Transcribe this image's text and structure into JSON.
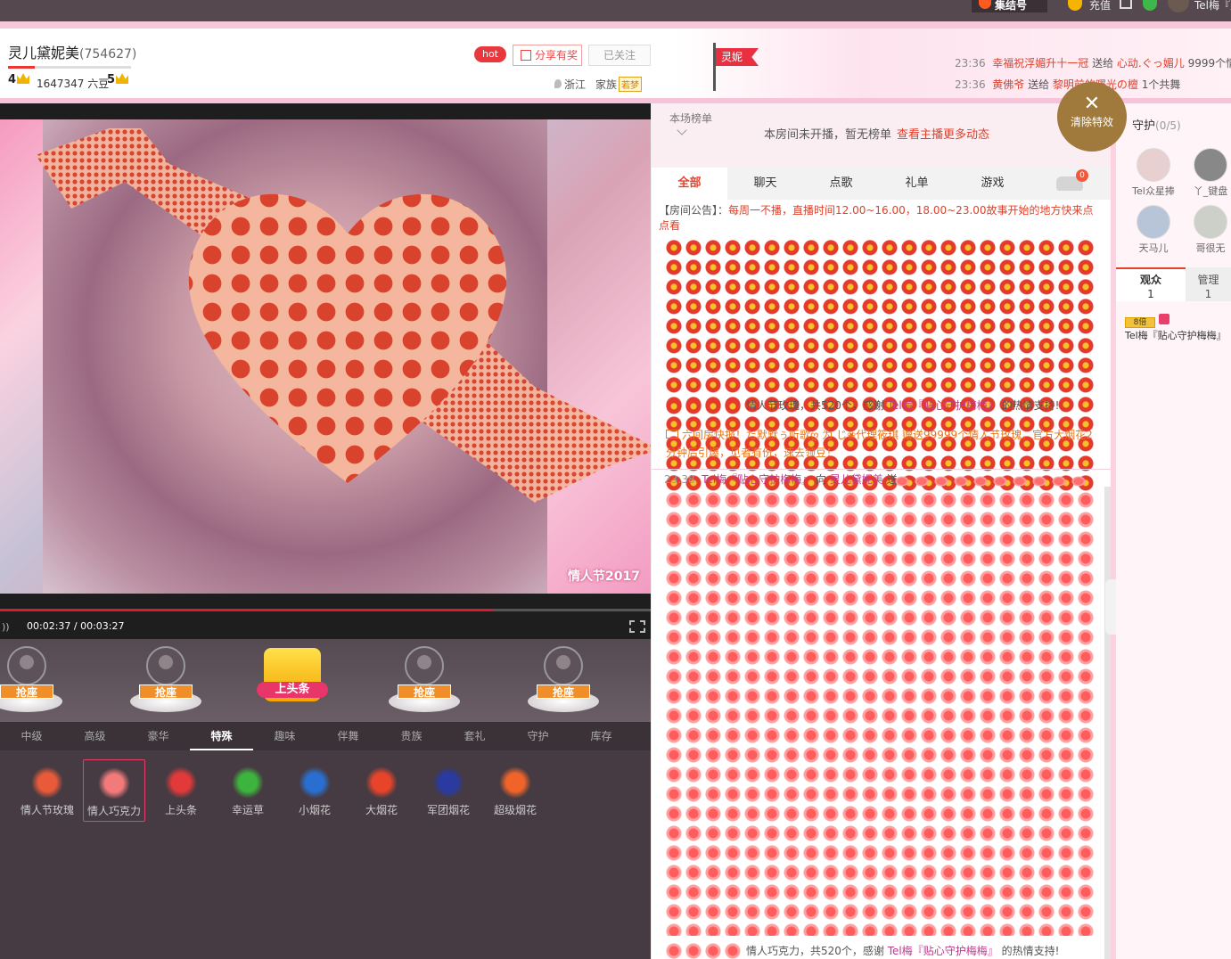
{
  "topbar": {
    "store": "集结号",
    "recharge": "充值",
    "username": "Tel梅『贴心"
  },
  "room": {
    "anchor_name": "灵儿黛妮美",
    "room_id": "(754627)",
    "level_left": "4",
    "coins": "1647347 六豆",
    "level_right": "5",
    "hot_label": "hot",
    "share_label": "分享有奖",
    "follow_label": "已关注",
    "location": "浙江",
    "family_label": "家族",
    "family_name": "若梦",
    "flag_name": "灵妮"
  },
  "feed": [
    {
      "time": "23:36",
      "sender": "幸福祝浮媚升十一冠",
      "verb": "送给",
      "receiver": "心动.ぐっ媚儿",
      "gift": "9999个情"
    },
    {
      "time": "23:36",
      "sender": "黄佛爷",
      "verb": "送给",
      "receiver": "黎明前的曙光の檀",
      "gift": "1个共舞"
    }
  ],
  "player": {
    "time": "00:02:37 / 00:03:27",
    "progress": 0.759,
    "badge": "情人节2017"
  },
  "seats": {
    "grab_label": "抢座",
    "headline_label": "上头条"
  },
  "gift_tabs": [
    "中级",
    "高级",
    "豪华",
    "特殊",
    "趣味",
    "伴舞",
    "贵族",
    "套礼",
    "守护",
    "库存"
  ],
  "gift_tab_active": "特殊",
  "gifts": [
    {
      "name": "情人节玫瑰",
      "icon": "rose-bouquet-icon",
      "color": "#e85a3a"
    },
    {
      "name": "情人巧克力",
      "icon": "chocolate-heart-icon",
      "color": "#f27a7a"
    },
    {
      "name": "上头条",
      "icon": "headline-sign-icon",
      "color": "#e23a3a"
    },
    {
      "name": "幸运草",
      "icon": "clover-icon",
      "color": "#3db43d"
    },
    {
      "name": "小烟花",
      "icon": "small-firework-icon",
      "color": "#2a6fd0"
    },
    {
      "name": "大烟花",
      "icon": "big-firework-icon",
      "color": "#e8442a"
    },
    {
      "name": "军团烟花",
      "icon": "legion-firework-icon",
      "color": "#2a3aa0"
    },
    {
      "name": "超级烟花",
      "icon": "super-firework-icon",
      "color": "#f0642a"
    }
  ],
  "chat": {
    "rank_label": "本场榜单",
    "rank_message": "本房间未开播，暂无榜单",
    "rank_link": "查看主播更多动态",
    "tabs": [
      "全部",
      "聊天",
      "点歌",
      "礼单",
      "游戏"
    ],
    "car_badge": "0",
    "notice_label": "【房间公告】：",
    "notice_text": "每周一不播，直播时间12.00~16.00，18.00~23.00故事开始的地方快来点点看",
    "thanks1_text": "情人节玫瑰，共520个，感谢",
    "thanks_user": "Tel梅『贴心守护梅梅』",
    "thanks_suffix": "的热情支持!",
    "system_text": "六间房快报！だ默默ぅ听歌ღ 为 じ❀代理筱琪 赠送99999个情人节玫瑰，官方大烟花2分钟后引爆，见者有份，速去领豆！",
    "msg_time": "23:38",
    "msg_sender": "Tel梅『贴心守护梅梅』",
    "msg_to": "向",
    "msg_receiver": "灵儿黛妮美",
    "msg_verb": "送",
    "thanks2_text": "情人巧克力，共520个，感谢"
  },
  "sidebar": {
    "clear_label": "清除特效",
    "guard_title": "守护",
    "guard_count": "(0/5)",
    "guardians": [
      "Tel众星捧",
      "丫_键盘",
      "天马儿",
      "哥很无"
    ],
    "tabs": [
      {
        "label": "观众",
        "count": "1"
      },
      {
        "label": "管理",
        "count": "1"
      }
    ],
    "viewer_vip": "8倍",
    "viewer_name": "Tel梅『贴心守护梅梅』"
  }
}
